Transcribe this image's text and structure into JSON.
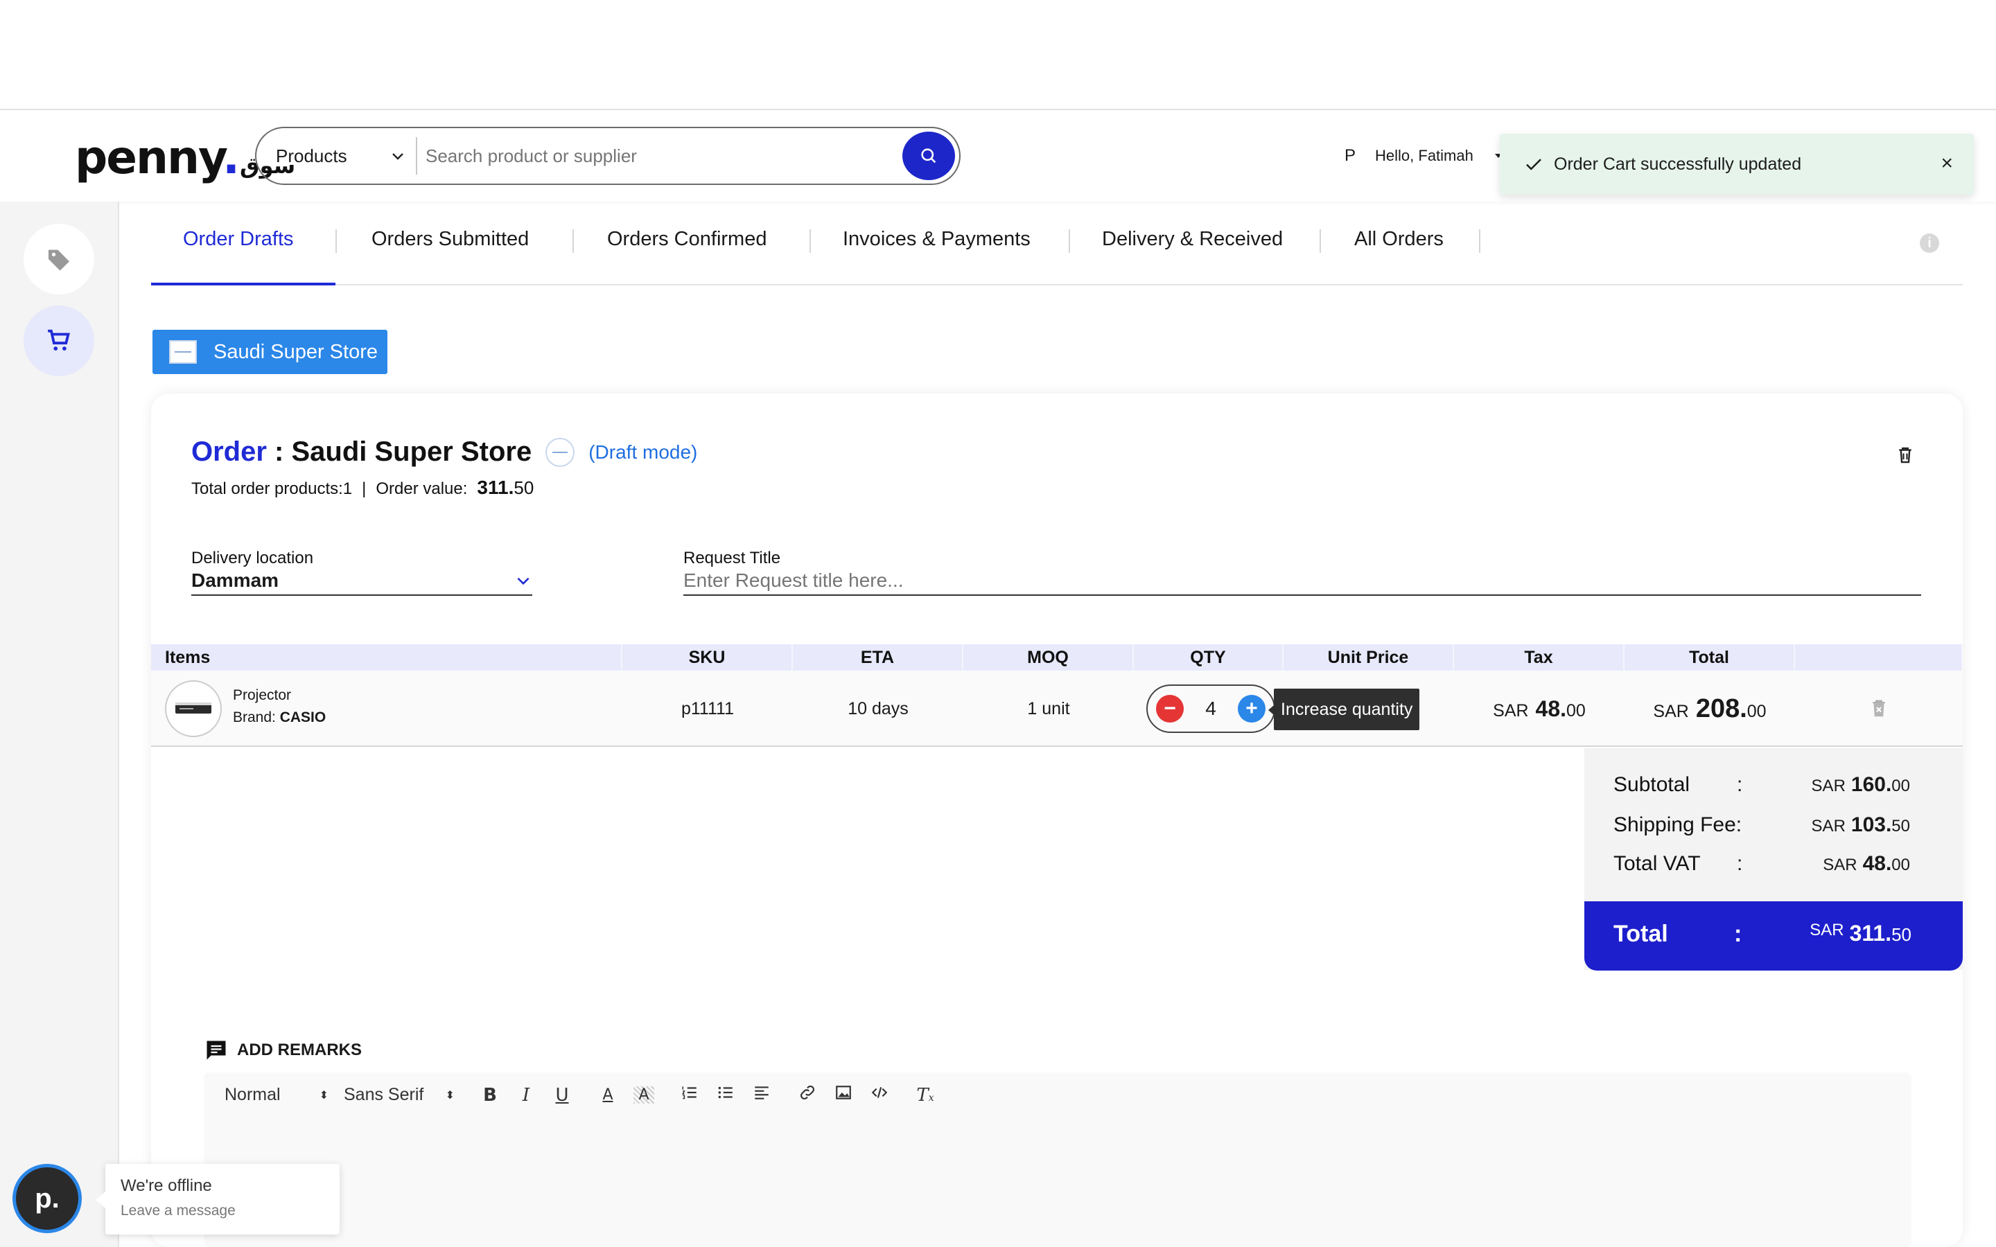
{
  "header": {
    "logo_text": "penny",
    "logo_arabic": "سوق",
    "search": {
      "category": "Products",
      "placeholder": "Search product or supplier"
    },
    "user": {
      "initial": "P",
      "greeting": "Hello, Fatimah"
    }
  },
  "toast": {
    "message": "Order Cart successfully updated",
    "close": "×"
  },
  "tabs": [
    {
      "label": "Order Drafts",
      "active": true
    },
    {
      "label": "Orders Submitted"
    },
    {
      "label": "Orders Confirmed"
    },
    {
      "label": "Invoices & Payments"
    },
    {
      "label": "Delivery & Received"
    },
    {
      "label": "All Orders"
    }
  ],
  "store_chip": "Saudi Super Store",
  "order": {
    "title_prefix": "Order",
    "title_sep": " : ",
    "store": "Saudi Super Store",
    "mode": "(Draft mode)",
    "products_label": "Total order products:1",
    "sep": "|",
    "value_label": "Order value:",
    "value_int": "311.",
    "value_dec": "50"
  },
  "delivery": {
    "label": "Delivery location",
    "value": "Dammam"
  },
  "request": {
    "label": "Request Title",
    "placeholder": "Enter Request title here..."
  },
  "table": {
    "headers": [
      "Items",
      "SKU",
      "ETA",
      "MOQ",
      "QTY",
      "Unit Price",
      "Tax",
      "Total"
    ],
    "row": {
      "name": "Projector",
      "brand_label": "Brand: ",
      "brand": "CASIO",
      "sku": "p11111",
      "eta": "10 days",
      "moq": "1 unit",
      "qty": "4",
      "tooltip": "Increase quantity",
      "tax_cur": "SAR",
      "tax_int": "48.",
      "tax_dec": "00",
      "total_cur": "SAR",
      "total_int": "208.",
      "total_dec": "00"
    }
  },
  "summary": {
    "subtotal_label": "Subtotal",
    "shipping_label": "Shipping Fee:",
    "vat_label": "Total VAT",
    "colon": ":",
    "currency": "SAR",
    "subtotal_int": "160.",
    "subtotal_dec": "00",
    "shipping_int": "103.",
    "shipping_dec": "50",
    "vat_int": "48.",
    "vat_dec": "00",
    "total_label": "Total",
    "total_int": "311.",
    "total_dec": "50"
  },
  "remarks": {
    "title": "ADD REMARKS",
    "format": "Normal",
    "font": "Sans Serif"
  },
  "chat": {
    "avatar": "p.",
    "status": "We're offline",
    "action": "Leave a message"
  },
  "colors": {
    "brand_blue": "#1f2ad6",
    "chip_blue": "#2b87e8",
    "toast_bg": "#e6f4ec",
    "minus_red": "#e53535"
  }
}
